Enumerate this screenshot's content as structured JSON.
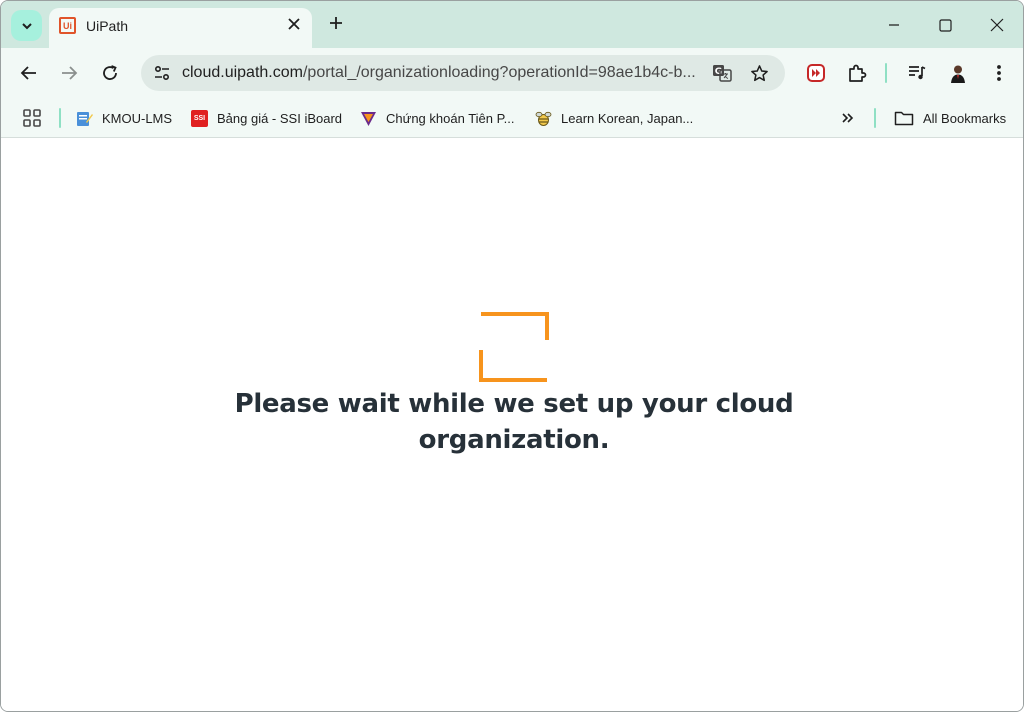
{
  "browser": {
    "tab": {
      "title": "UiPath",
      "favicon_text": "Ui"
    },
    "url": {
      "host": "cloud.uipath.com",
      "path": "/portal_/organizationloading?operationId=98ae1b4c-b..."
    },
    "bookmarks": [
      {
        "label": "KMOU-LMS",
        "icon": "notepad-icon"
      },
      {
        "label": "Bảng giá - SSI iBoard",
        "icon": "ssi-icon",
        "icon_text": "SSI"
      },
      {
        "label": "Chứng khoán Tiên P...",
        "icon": "tpbs-icon"
      },
      {
        "label": "Learn Korean, Japan...",
        "icon": "bee-icon"
      }
    ],
    "all_bookmarks_label": "All Bookmarks"
  },
  "page": {
    "message": "Please wait while we set up your cloud organization.",
    "accent_color": "#f7941d"
  }
}
